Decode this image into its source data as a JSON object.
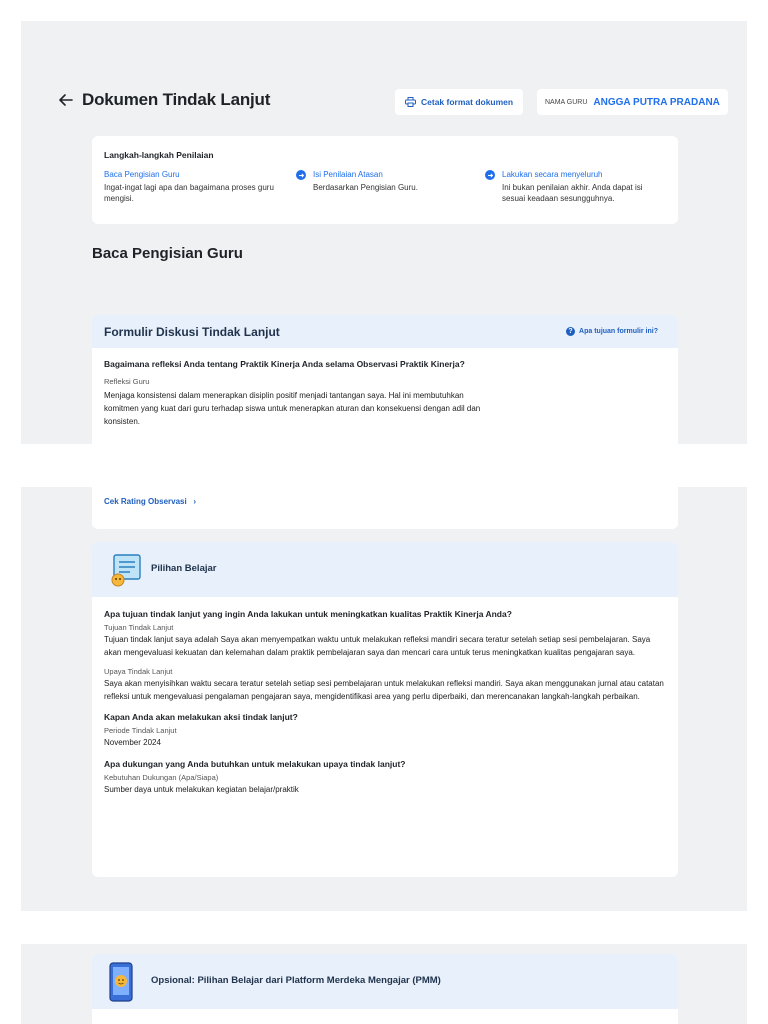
{
  "header": {
    "title": "Dokumen Tindak Lanjut",
    "print_label": "Cetak format dokumen",
    "teacher_label": "NAMA GURU",
    "teacher_name": "ANGGA PUTRA PRADANA"
  },
  "steps": {
    "title": "Langkah-langkah Penilaian",
    "items": [
      {
        "link": "Baca Pengisian Guru",
        "desc": "Ingat-ingat lagi apa dan bagaimana proses guru mengisi."
      },
      {
        "link": "Isi Penilaian Atasan",
        "desc": "Berdasarkan Pengisian Guru."
      },
      {
        "link": "Lakukan secara menyeluruh",
        "desc": "Ini bukan penilaian akhir. Anda dapat isi sesuai keadaan sesungguhnya."
      }
    ]
  },
  "section_title": "Baca Pengisian Guru",
  "form": {
    "title": "Formulir Diskusi Tindak Lanjut",
    "help": "Apa tujuan formulir ini?",
    "question": "Bagaimana refleksi Anda tentang Praktik Kinerja Anda selama Observasi Praktik Kinerja?",
    "label": "Refleksi Guru",
    "answer": "Menjaga konsistensi dalam menerapkan disiplin positif menjadi tantangan saya. Hal ini membutuhkan komitmen yang kuat dari guru terhadap siswa untuk menerapkan aturan dan konsekuensi dengan adil dan konsisten."
  },
  "rating_link": "Cek Rating Observasi",
  "learning": {
    "title": "Pilihan Belajar",
    "q1": "Apa tujuan tindak lanjut yang ingin Anda lakukan untuk meningkatkan kualitas Praktik Kinerja Anda?",
    "l1": "Tujuan Tindak Lanjut",
    "a1": "Tujuan tindak lanjut saya adalah Saya akan menyempatkan waktu untuk melakukan refleksi mandiri secara teratur setelah setiap sesi pembelajaran. Saya akan mengevaluasi kekuatan dan kelemahan dalam praktik pembelajaran saya dan mencari cara untuk terus meningkatkan kualitas pengajaran saya.",
    "l2": "Upaya Tindak Lanjut",
    "a2": "Saya akan menyisihkan waktu secara teratur setelah setiap sesi pembelajaran untuk melakukan refleksi mandiri. Saya akan menggunakan jurnal atau catatan refleksi untuk mengevaluasi pengalaman pengajaran saya, mengidentifikasi area yang perlu diperbaiki, dan merencanakan langkah-langkah perbaikan.",
    "q2": "Kapan Anda akan melakukan aksi tindak lanjut?",
    "l3": "Periode Tindak Lanjut",
    "a3": "November 2024",
    "q3": "Apa dukungan yang Anda butuhkan untuk melakukan upaya tindak lanjut?",
    "l4": "Kebutuhan Dukungan (Apa/Siapa)",
    "a4": "Sumber daya untuk melakukan kegiatan belajar/praktik"
  },
  "pmm": {
    "title": "Opsional: Pilihan Belajar dari Platform Merdeka Mengajar (PMM)"
  },
  "colors": {
    "accent": "#1f6feb",
    "panel_bg": "#f0f1f3",
    "card_head_bg": "#e7f0fb"
  }
}
